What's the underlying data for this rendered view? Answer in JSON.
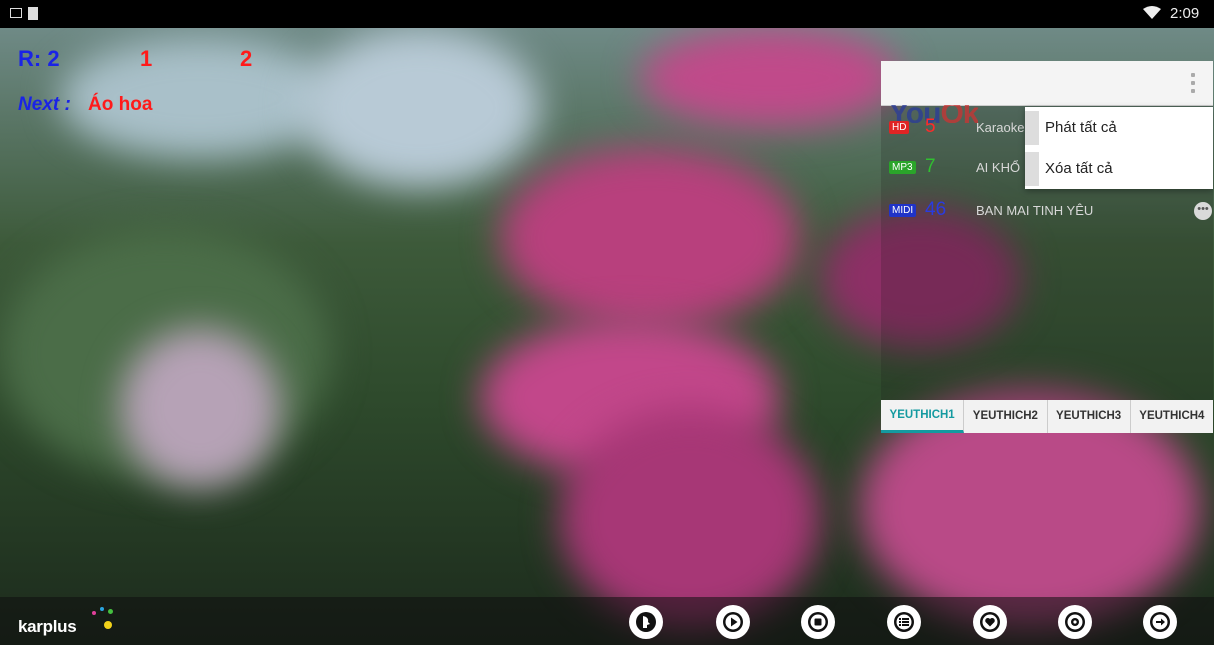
{
  "status_bar": {
    "time": "2:09",
    "icons": [
      "gallery-icon",
      "sim-icon",
      "wifi-icon"
    ]
  },
  "overlay": {
    "remaining_label": "R: 2",
    "value_1": "1",
    "value_2": "2",
    "next_label": "Next :",
    "next_song": "Áo hoa",
    "colors": {
      "blue": "#1a23e6",
      "red": "#ff1a1a"
    }
  },
  "playlist": {
    "header_menu_icon": "overflow-menu-icon",
    "songs": [
      {
        "format": "HD",
        "number": "5",
        "title": "Karaoke in HỌC MỖ",
        "format_color": "#e02424",
        "number_color": "#ff2a2a"
      },
      {
        "format": "MP3",
        "number": "7",
        "title": "AI KHỔ",
        "format_color": "#2aa52a",
        "number_color": "#30c030"
      },
      {
        "format": "MIDI",
        "number": "46",
        "title": "BAN MAI TINH YÊU",
        "format_color": "#2033c8",
        "number_color": "#2a3be0"
      }
    ],
    "tabs": [
      {
        "label": "YEUTHICH1",
        "active": true
      },
      {
        "label": "YEUTHICH2",
        "active": false
      },
      {
        "label": "YEUTHICH3",
        "active": false
      },
      {
        "label": "YEUTHICH4",
        "active": false
      }
    ],
    "accent_color": "#149aa0"
  },
  "popup_menu": {
    "items": [
      "Phát tất cả",
      "Xóa tất cả"
    ]
  },
  "bottom_bar": {
    "logo_text": "karplus",
    "controls": [
      "vocal-icon",
      "play-icon",
      "stop-icon",
      "playlist-icon",
      "favorite-icon",
      "settings-icon",
      "exit-icon"
    ]
  }
}
